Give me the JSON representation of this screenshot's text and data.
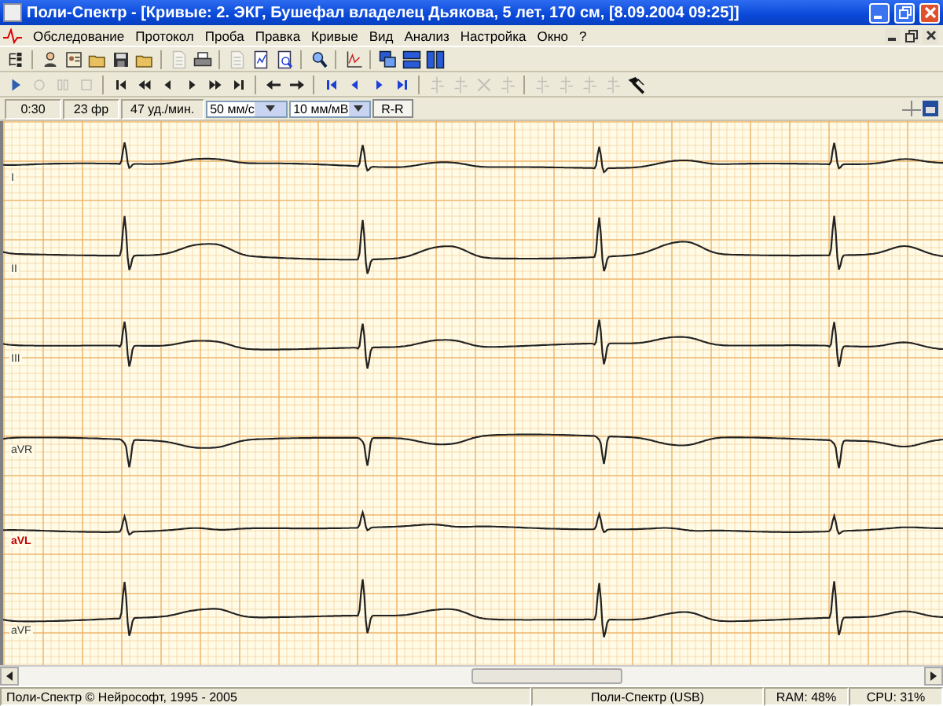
{
  "window": {
    "title": "Поли-Спектр - [Кривые: 2. ЭКГ, Бушефал владелец Дьякова, 5 лет, 170 см, [8.09.2004 09:25]]"
  },
  "menu": [
    "Обследование",
    "Протокол",
    "Проба",
    "Правка",
    "Кривые",
    "Вид",
    "Анализ",
    "Настройка",
    "Окно",
    "?"
  ],
  "toolbar_1": [
    {
      "kind": "tree",
      "disabled": false
    },
    {
      "kind": "separator"
    },
    {
      "kind": "person",
      "disabled": false
    },
    {
      "kind": "card",
      "disabled": false
    },
    {
      "kind": "folder",
      "disabled": false
    },
    {
      "kind": "floppy",
      "disabled": false
    },
    {
      "kind": "folder",
      "disabled": false
    },
    {
      "kind": "separator"
    },
    {
      "kind": "page",
      "disabled": true
    },
    {
      "kind": "printer",
      "disabled": false
    },
    {
      "kind": "separator"
    },
    {
      "kind": "page",
      "disabled": true
    },
    {
      "kind": "page-chart",
      "disabled": false
    },
    {
      "kind": "page-search",
      "disabled": false
    },
    {
      "kind": "separator"
    },
    {
      "kind": "magnifier",
      "disabled": false
    },
    {
      "kind": "separator"
    },
    {
      "kind": "chart-axes",
      "disabled": false
    },
    {
      "kind": "separator"
    },
    {
      "kind": "cascade",
      "disabled": false
    },
    {
      "kind": "rows",
      "disabled": false
    },
    {
      "kind": "columns",
      "disabled": false
    }
  ],
  "toolbar_2": [
    {
      "kind": "play",
      "disabled": false
    },
    {
      "kind": "record",
      "disabled": true
    },
    {
      "kind": "pause",
      "disabled": true
    },
    {
      "kind": "stop",
      "disabled": true
    },
    {
      "kind": "separator"
    },
    {
      "kind": "first",
      "disabled": false
    },
    {
      "kind": "rewind",
      "disabled": false
    },
    {
      "kind": "prev",
      "disabled": false
    },
    {
      "kind": "next",
      "disabled": false
    },
    {
      "kind": "fast-forward",
      "disabled": false
    },
    {
      "kind": "last",
      "disabled": false
    },
    {
      "kind": "separator"
    },
    {
      "kind": "arrow-left",
      "disabled": false
    },
    {
      "kind": "arrow-right",
      "disabled": false
    },
    {
      "kind": "separator"
    },
    {
      "kind": "nav-first",
      "disabled": false
    },
    {
      "kind": "nav-prev",
      "disabled": false
    },
    {
      "kind": "nav-next",
      "disabled": false
    },
    {
      "kind": "nav-last",
      "disabled": false
    },
    {
      "kind": "separator"
    },
    {
      "kind": "marker",
      "disabled": true
    },
    {
      "kind": "marker",
      "disabled": true
    },
    {
      "kind": "cross",
      "disabled": true
    },
    {
      "kind": "marker",
      "disabled": true
    },
    {
      "kind": "separator"
    },
    {
      "kind": "marker",
      "disabled": true
    },
    {
      "kind": "marker",
      "disabled": true
    },
    {
      "kind": "marker",
      "disabled": true
    },
    {
      "kind": "marker",
      "disabled": true
    },
    {
      "kind": "hammer",
      "disabled": false
    }
  ],
  "info_bar": [
    {
      "kind": "readout",
      "text": "0:30"
    },
    {
      "kind": "readout",
      "text": "23 фр"
    },
    {
      "kind": "readout",
      "text": "47 уд./мин."
    },
    {
      "kind": "dropdown",
      "value": "50 мм/с"
    },
    {
      "kind": "dropdown",
      "value": "10 мм/мВ"
    },
    {
      "kind": "button",
      "label": "R-R"
    }
  ],
  "leads": [
    {
      "label": "I",
      "selected": false
    },
    {
      "label": "II",
      "selected": false
    },
    {
      "label": "III",
      "selected": false
    },
    {
      "label": "aVR",
      "selected": false
    },
    {
      "label": "aVL",
      "selected": true
    },
    {
      "label": "aVF",
      "selected": false
    }
  ],
  "status_bar": [
    "Поли-Спектр © Нейрософт, 1995 - 2005",
    "Поли-Спектр (USB)",
    "RAM: 48%",
    "CPU: 31%"
  ]
}
